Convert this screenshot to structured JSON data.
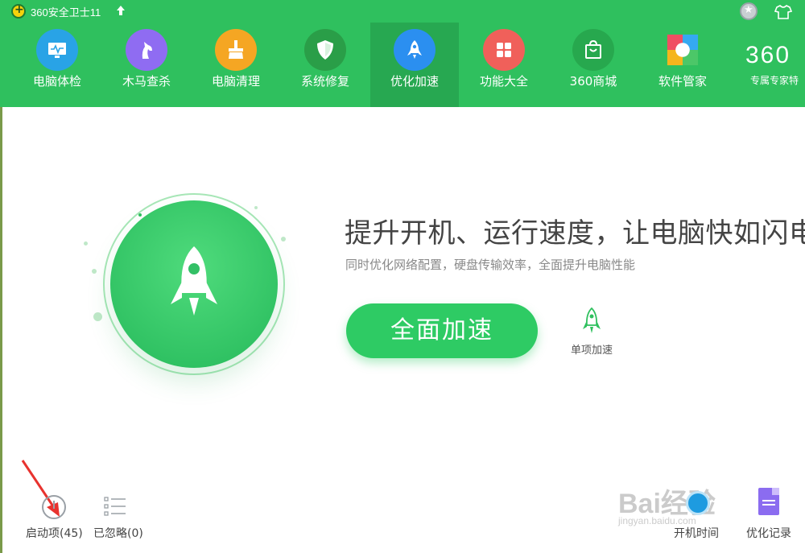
{
  "titlebar": {
    "app_title": "360安全卫士11",
    "icons": [
      "app-logo-icon",
      "upgrade-arrow-icon",
      "medal-icon",
      "skin-shirt-icon"
    ]
  },
  "nav": {
    "items": [
      {
        "label": "电脑体检",
        "icon": "monitor-icon",
        "color": "#29a3e6"
      },
      {
        "label": "木马查杀",
        "icon": "horse-icon",
        "color": "#8f6cf2"
      },
      {
        "label": "电脑清理",
        "icon": "broom-icon",
        "color": "#f5a623"
      },
      {
        "label": "系统修复",
        "icon": "shield-icon",
        "color": "#2a9e48"
      },
      {
        "label": "优化加速",
        "icon": "rocket-icon",
        "color": "#2b8ff0",
        "active": true
      },
      {
        "label": "功能大全",
        "icon": "grid-icon",
        "color": "#f0605a"
      },
      {
        "label": "360商城",
        "icon": "shopping-bag-icon",
        "color": "#27a84e"
      },
      {
        "label": "软件管家",
        "icon": "software-icon",
        "color": "#f2f2f2"
      }
    ],
    "brand_mark": "360",
    "brand_sub": "专属专家特"
  },
  "main": {
    "headline": "提升开机、运行速度，让电脑快如闪电",
    "subline": "同时优化网络配置，硬盘传输效率，全面提升电脑性能",
    "accel_button": "全面加速",
    "single_accel": "单项加速"
  },
  "bottom": {
    "startup_label": "启动项(45)",
    "ignored_label": "已忽略(0)",
    "boot_time_label": "开机时间",
    "record_label": "优化记录"
  },
  "watermark": {
    "text": "Bai经验",
    "url": "jingyan.baidu.com"
  },
  "colors": {
    "header_green": "#2fc05e",
    "active_tab": "#27a851",
    "button_green": "#2ecb64"
  }
}
